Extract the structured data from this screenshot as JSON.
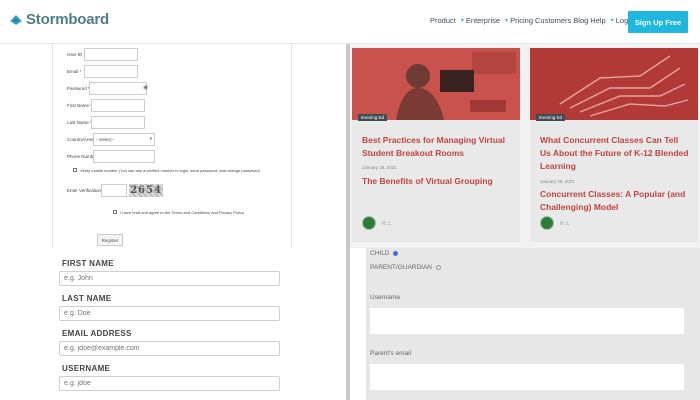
{
  "header": {
    "logo_text": "Stormboard",
    "nav": [
      "Product",
      "Enterprise",
      "Pricing",
      "Customers",
      "Blog",
      "Help",
      "Login →"
    ],
    "signup_label": "Sign Up Free",
    "accent_color": "#1fb6e0",
    "brand_color": "#4f7d8c"
  },
  "signup_form": {
    "fields": [
      {
        "label": "User ID *"
      },
      {
        "label": "Email *"
      },
      {
        "label": "Password *"
      },
      {
        "label": "First Name *"
      },
      {
        "label": "Last Name *"
      },
      {
        "label": "Country/Area *",
        "value": "--Select--"
      },
      {
        "label": "Phone Number"
      }
    ],
    "mobile_note": "Verify mobile number (You can use a verified number to login, send password, and change password)",
    "captcha_label": "Enter Verification Code *",
    "captcha_text": "2654",
    "terms_text": "I have read and agree to the Terms and Conditions and Privacy Policy",
    "register_label": "Register"
  },
  "user_form": {
    "fields": [
      {
        "label": "FIRST NAME",
        "placeholder": "e.g. John"
      },
      {
        "label": "LAST NAME",
        "placeholder": "e.g. Doe"
      },
      {
        "label": "EMAIL ADDRESS",
        "placeholder": "e.g. jdoe@example.com"
      },
      {
        "label": "USERNAME",
        "placeholder": "e.g. jdoe"
      }
    ]
  },
  "cards": [
    {
      "tag": "Evening Ed",
      "title": "Best Practices for Managing Virtual Student Breakout Rooms",
      "date": "January 28, 2021",
      "link": "The Benefits of Virtual Grouping",
      "author": "H. L."
    },
    {
      "tag": "Evening Ed",
      "title": "What Concurrent Classes Can Tell Us About the Future of K-12 Blended Learning",
      "date": "January 28, 2021",
      "link": "Concurrent Classes: A Popular (and Challenging) Model",
      "author": "H. L."
    }
  ],
  "role_form": {
    "option_child": "CHILD",
    "option_parent": "PARENT/GUARDIAN",
    "selected": "CHILD",
    "username_label": "Username",
    "parent_email_label": "Parent's email"
  }
}
